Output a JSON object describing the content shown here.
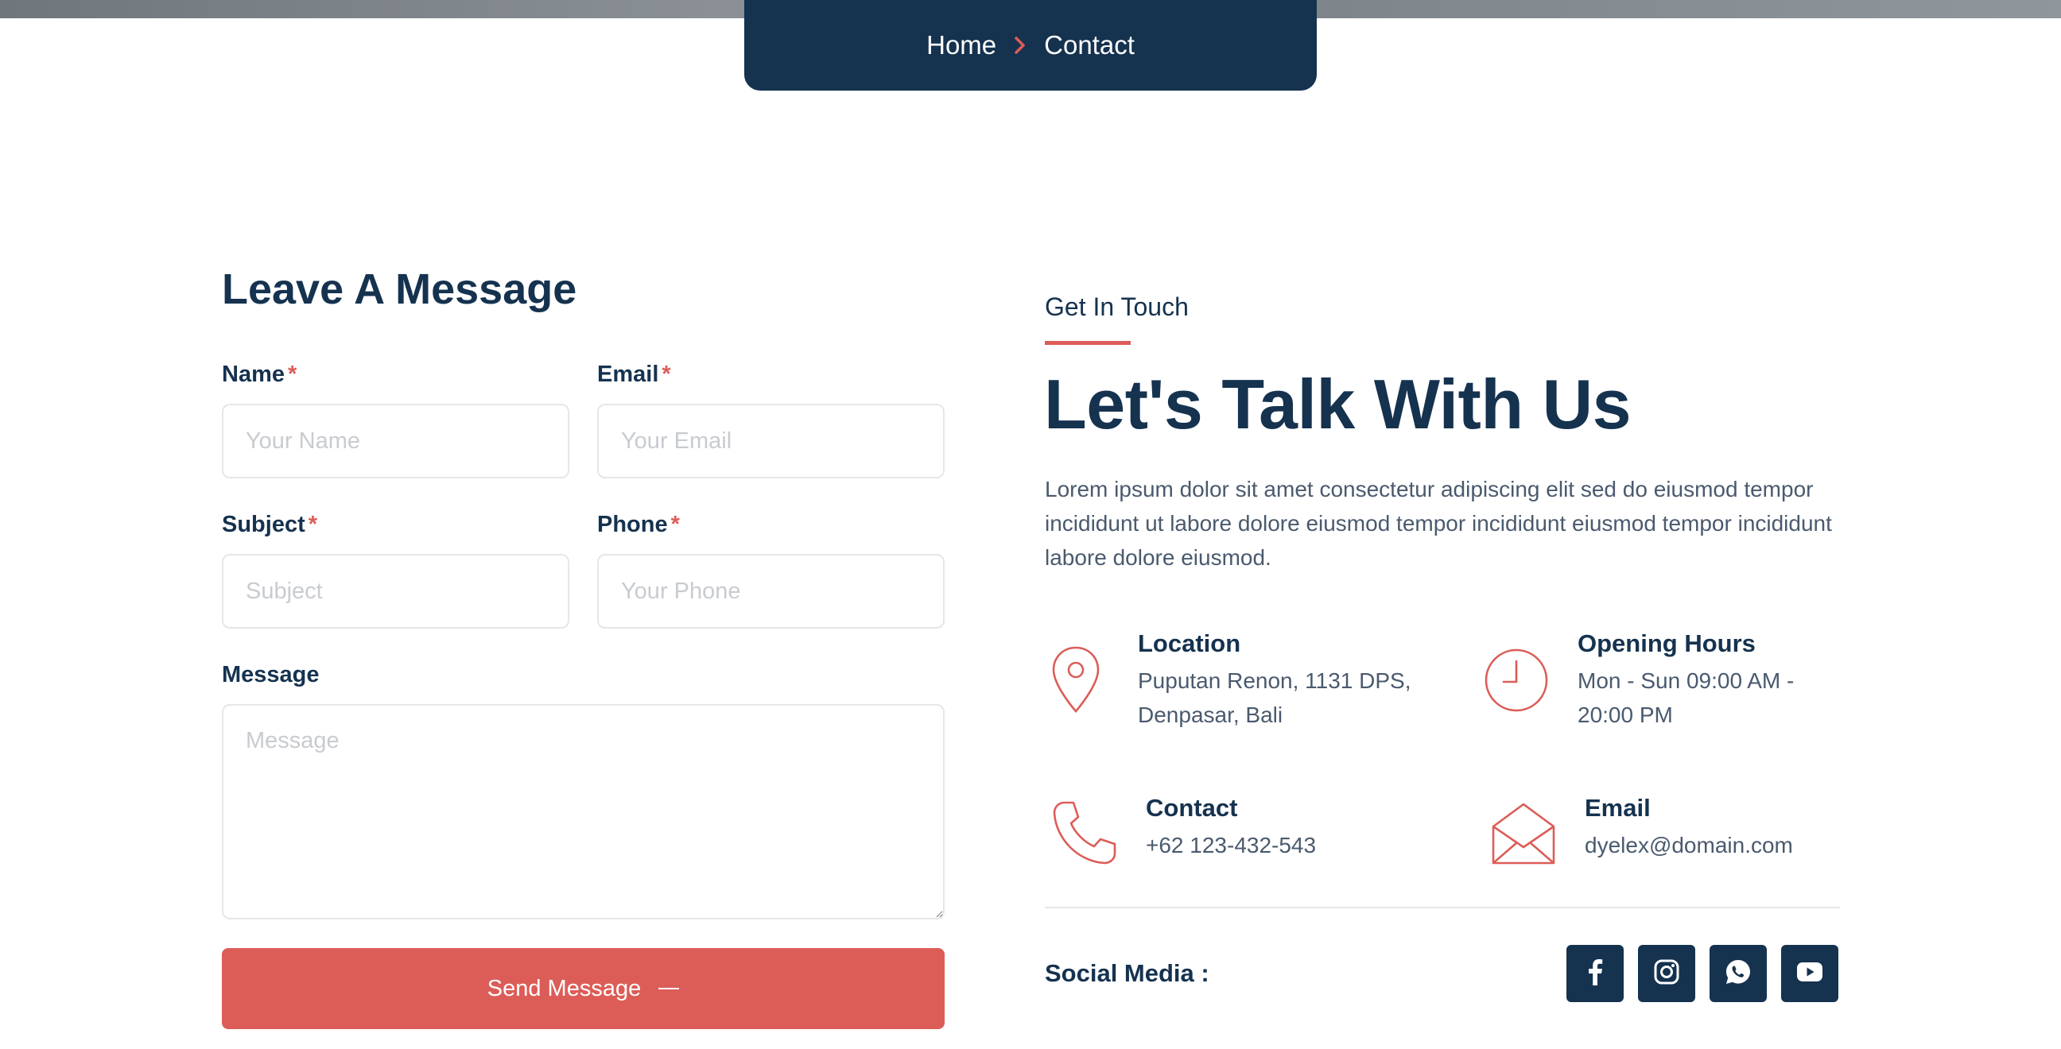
{
  "breadcrumb": {
    "home": "Home",
    "current": "Contact"
  },
  "form": {
    "title": "Leave A Message",
    "required_mark": "*",
    "name": {
      "label": "Name",
      "placeholder": "Your Name"
    },
    "email": {
      "label": "Email",
      "placeholder": "Your Email"
    },
    "subject": {
      "label": "Subject",
      "placeholder": "Subject"
    },
    "phone": {
      "label": "Phone",
      "placeholder": "Your Phone"
    },
    "message": {
      "label": "Message",
      "placeholder": "Message"
    },
    "submit_label": "Send Message"
  },
  "contact_info": {
    "kicker": "Get In Touch",
    "title": "Let's Talk With Us",
    "intro": "Lorem ipsum dolor sit amet consectetur adipiscing elit sed do eiusmod tempor incididunt ut labore dolore eiusmod tempor incididunt eiusmod tempor incididunt labore dolore eiusmod.",
    "location": {
      "title": "Location",
      "line1": "Puputan Renon, 1131 DPS,",
      "line2": "Denpasar, Bali",
      "icon": "map-pin-icon"
    },
    "hours": {
      "title": "Opening Hours",
      "line1": "Mon - Sun 09:00 AM -",
      "line2": "20:00 PM",
      "icon": "clock-icon"
    },
    "phone": {
      "title": "Contact",
      "value": "+62 123-432-543",
      "icon": "phone-icon"
    },
    "email": {
      "title": "Email",
      "value": "dyelex@domain.com",
      "icon": "envelope-open-icon"
    },
    "social_label": "Social Media :",
    "social": [
      "facebook-icon",
      "instagram-icon",
      "whatsapp-icon",
      "youtube-icon"
    ]
  },
  "colors": {
    "navy": "#15324f",
    "accent": "#dc5d58",
    "text_muted": "#4a5a6e",
    "border": "#e4e7ea"
  }
}
